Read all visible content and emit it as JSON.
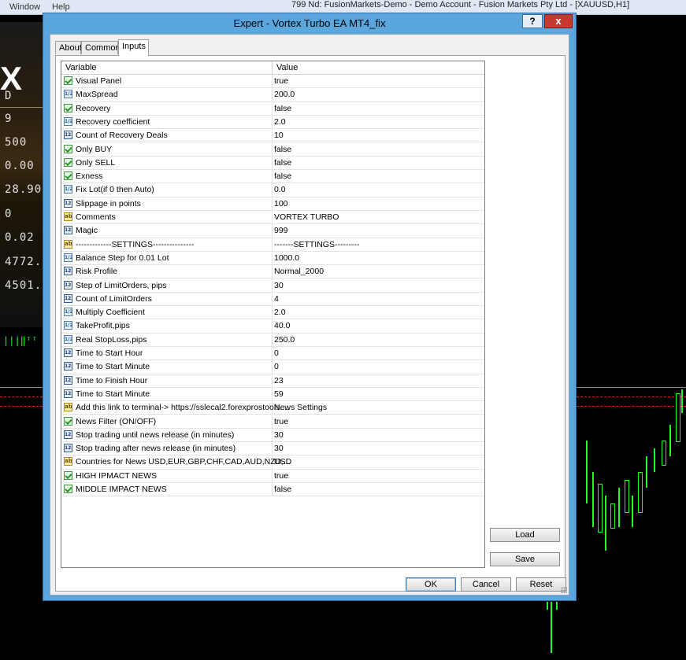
{
  "background": {
    "menu": [
      "Window",
      "Help"
    ],
    "title": "799 Nd: FusionMarkets-Demo - Demo Account - Fusion Markets Pty Ltd - [XAUUSD,H1]",
    "panel_logo": "X",
    "panel_values": [
      "D",
      "9",
      "500",
      "0.00",
      "28.90",
      "0",
      "0.02",
      "4772.",
      "4501."
    ]
  },
  "dialog": {
    "title": "Expert - Vortex Turbo EA MT4_fix",
    "help_label": "?",
    "close_label": "x",
    "tabs": [
      {
        "label": "About",
        "active": false
      },
      {
        "label": "Common",
        "active": false
      },
      {
        "label": "Inputs",
        "active": true
      }
    ],
    "columns": {
      "variable": "Variable",
      "value": "Value"
    },
    "rows": [
      {
        "type": "bool",
        "name": "Visual Panel",
        "value": "true"
      },
      {
        "type": "dbl",
        "name": "MaxSpread",
        "value": "200.0"
      },
      {
        "type": "bool",
        "name": "Recovery",
        "value": "false"
      },
      {
        "type": "dbl",
        "name": "Recovery coefficient",
        "value": "2.0"
      },
      {
        "type": "int",
        "name": "Count of Recovery Deals",
        "value": "10"
      },
      {
        "type": "bool",
        "name": "Only BUY",
        "value": "false"
      },
      {
        "type": "bool",
        "name": "Only SELL",
        "value": "false"
      },
      {
        "type": "bool",
        "name": "Exness",
        "value": "false"
      },
      {
        "type": "dbl",
        "name": "Fix Lot(if 0 then Auto)",
        "value": "0.0"
      },
      {
        "type": "int",
        "name": "Slippage in points",
        "value": "100"
      },
      {
        "type": "str",
        "name": "Comments",
        "value": "VORTEX TURBO"
      },
      {
        "type": "int",
        "name": "Magic",
        "value": "999"
      },
      {
        "type": "str",
        "name": "-------------SETTINGS---------------",
        "value": "-------SETTINGS---------"
      },
      {
        "type": "dbl",
        "name": "Balance Step for 0.01 Lot",
        "value": "1000.0"
      },
      {
        "type": "int",
        "name": "Risk Profile",
        "value": "Normal_2000"
      },
      {
        "type": "int",
        "name": "Step of LimitOrders, pips",
        "value": "30"
      },
      {
        "type": "int",
        "name": "Count of LimitOrders",
        "value": "4"
      },
      {
        "type": "dbl",
        "name": "Multiply Coefficient",
        "value": "2.0"
      },
      {
        "type": "dbl",
        "name": "TakeProfit,pips",
        "value": "40.0"
      },
      {
        "type": "dbl",
        "name": "Real StopLoss,pips",
        "value": "250.0"
      },
      {
        "type": "int",
        "name": "Time to Start Hour",
        "value": "0"
      },
      {
        "type": "int",
        "name": "Time to Start Minute",
        "value": "0"
      },
      {
        "type": "int",
        "name": "Time to Finish Hour",
        "value": "23"
      },
      {
        "type": "int",
        "name": "Time to Start Minute",
        "value": "59"
      },
      {
        "type": "str",
        "name": "Add this link to terminal-> https://sslecal2.forexprostools....",
        "value": "News Settings"
      },
      {
        "type": "bool",
        "name": "News Filter (ON/OFF)",
        "value": "true"
      },
      {
        "type": "int",
        "name": "Stop trading until news release (in minutes)",
        "value": "30"
      },
      {
        "type": "int",
        "name": "Stop trading after news release (in minutes)",
        "value": "30"
      },
      {
        "type": "str",
        "name": "Countries for News USD,EUR,GBP,CHF,CAD,AUD,NZD,...",
        "value": "USD"
      },
      {
        "type": "bool",
        "name": "HIGH IPMACT NEWS",
        "value": "true"
      },
      {
        "type": "bool",
        "name": "MIDDLE IMPACT NEWS",
        "value": "false"
      }
    ],
    "icons": {
      "bool": "checkmark-icon",
      "dbl": "1/2",
      "int": "123",
      "str": "ab"
    },
    "buttons": {
      "load": "Load",
      "save": "Save",
      "ok": "OK",
      "cancel": "Cancel",
      "reset": "Reset"
    }
  }
}
